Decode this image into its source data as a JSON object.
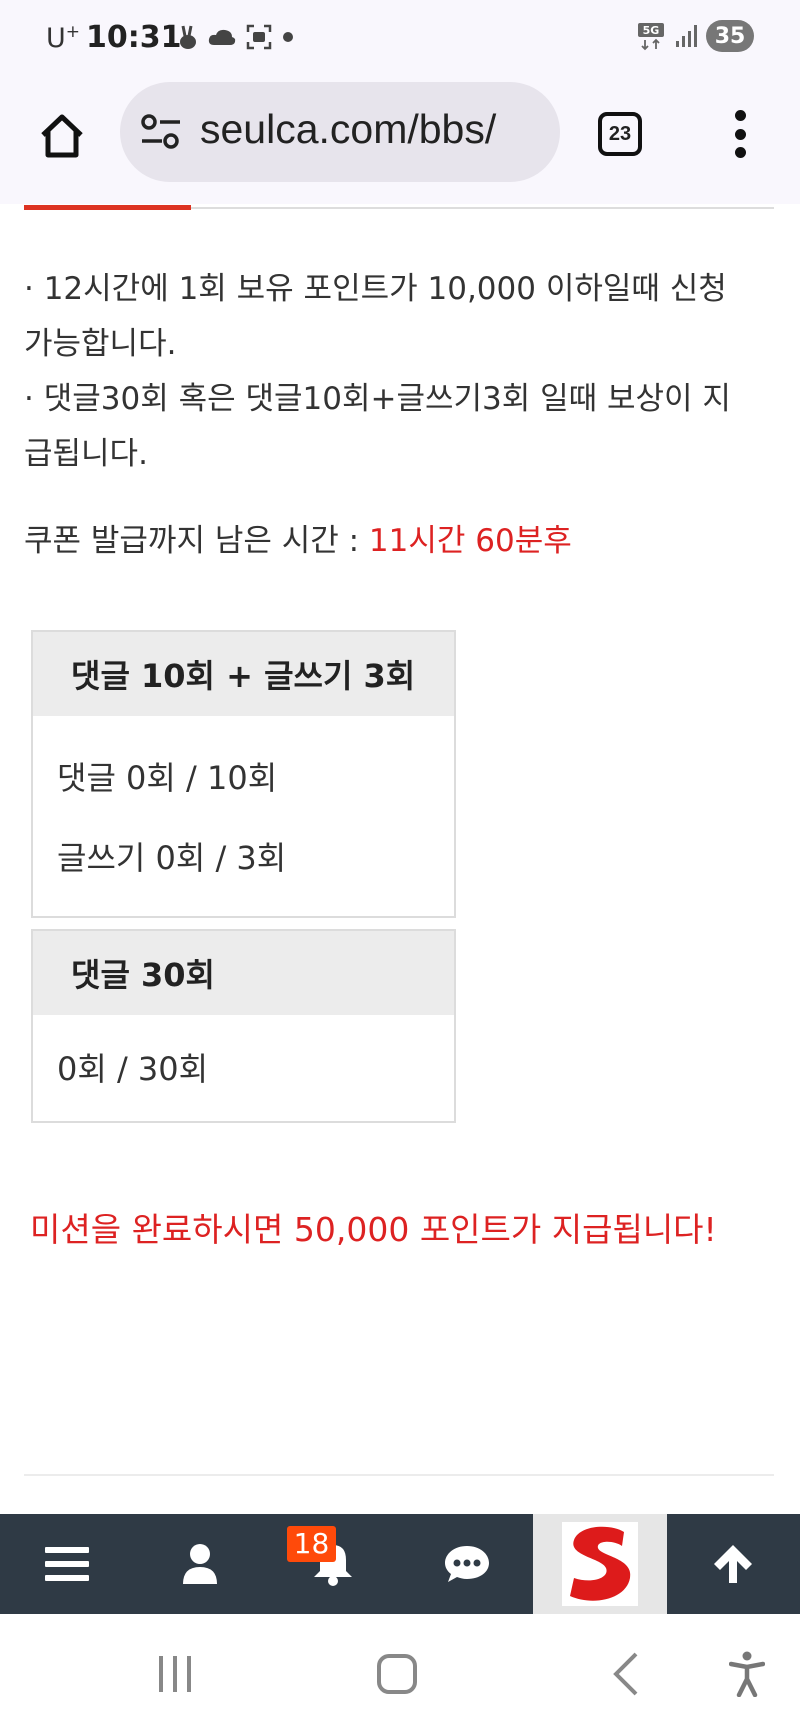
{
  "status_bar": {
    "carrier": "U",
    "carrier_sup": "+",
    "time": "10:31",
    "network": "5G",
    "battery": "35"
  },
  "browser": {
    "url": "seulca.com/bbs/",
    "tab_count": "23"
  },
  "content": {
    "rule_1a": "· 12시간에 1회 보유 포인트가 10,000 이하일때 신청",
    "rule_1b": "가능합니다.",
    "rule_2a": "· 댓글30회 혹은 댓글10회+글쓰기3회 일때 보상이 지",
    "rule_2b": "급됩니다.",
    "countdown_label": "쿠폰 발급까지 남은 시간 : ",
    "countdown_value": "11시간 60분후"
  },
  "mission1": {
    "title": "댓글 10회 + 글쓰기 3회",
    "comment_progress": "댓글 0회 / 10회",
    "post_progress": "글쓰기 0회 / 3회"
  },
  "mission2": {
    "title": "댓글 30회",
    "progress": "0회 / 30회"
  },
  "complete_message": "미션을 완료하시면 50,000 포인트가 지급됩니다!",
  "bottom_nav": {
    "notification_badge": "18"
  },
  "colors": {
    "accent_red": "#dd2222",
    "nav_bg": "#2f3a45",
    "badge": "#ff4a0a"
  },
  "icons": [
    "hamburger-menu-icon",
    "user-icon",
    "bell-icon",
    "chat-icon",
    "site-logo",
    "arrow-up-icon"
  ]
}
